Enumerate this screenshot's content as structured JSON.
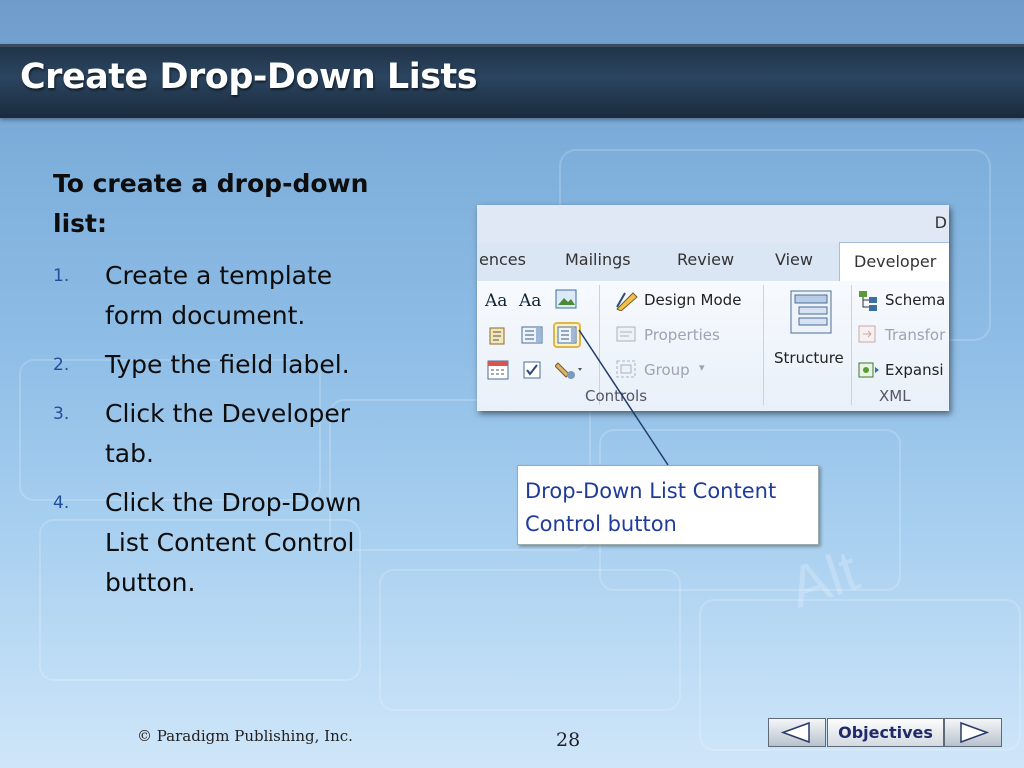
{
  "slide": {
    "title": "Create Drop-Down Lists",
    "intro": "To create a drop-down list:",
    "steps": [
      {
        "num": "1.",
        "text": "Create a template form document."
      },
      {
        "num": "2.",
        "text": "Type the field label."
      },
      {
        "num": "3.",
        "text": "Click the Developer tab."
      },
      {
        "num": "4.",
        "text": "Click the Drop-Down List Content Control button."
      }
    ],
    "callout": "Drop-Down List Content Control button",
    "footer": "© Paradigm Publishing, Inc.",
    "page_number": "28"
  },
  "ribbon": {
    "window_letter": "D",
    "tabs": [
      "ences",
      "Mailings",
      "Review",
      "View",
      "Developer"
    ],
    "active_tab": "Developer",
    "controls_group": {
      "label": "Controls",
      "commands": [
        "Design Mode",
        "Properties",
        "Group"
      ],
      "text_icons": [
        "Aa",
        "Aa"
      ]
    },
    "structure_label": "Structure",
    "xml_group": {
      "label": "XML",
      "commands": [
        "Schema",
        "Transfor",
        "Expansi"
      ]
    }
  },
  "navigation": {
    "objectives_label": "Objectives",
    "prev_icon": "triangle-left-icon",
    "next_icon": "triangle-right-icon"
  },
  "colors": {
    "title_bar": "#22374d",
    "numbering": "#1f4e9a",
    "callout_text": "#1f3c9a"
  }
}
